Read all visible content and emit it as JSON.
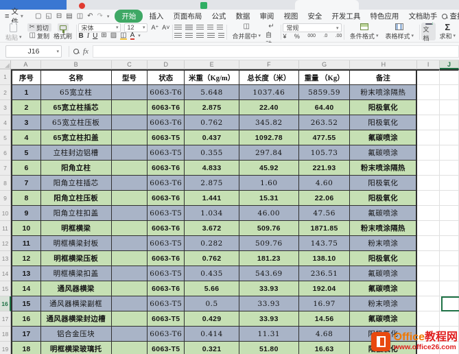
{
  "menu": {
    "file_label": "文件",
    "tabs": [
      "开始",
      "插入",
      "页面布局",
      "公式",
      "数据",
      "审阅",
      "视图",
      "安全",
      "开发工具",
      "特色应用",
      "文档助手"
    ],
    "active_tab": "开始",
    "search_label": "查找"
  },
  "ribbon": {
    "paste_label": "粘贴",
    "cut_label": "剪切",
    "copy_label": "复制",
    "format_painter_label": "格式刷",
    "font_name": "宋体",
    "font_size": "12",
    "merge_center_label": "合并居中",
    "wrap_text_label": "自动换行",
    "number_format_value": "常规",
    "conditional_format_label": "条件格式",
    "table_style_label": "表格样式",
    "doc_assistant_label": "文档助手",
    "sum_label": "求和"
  },
  "formula_bar": {
    "name_box": "J16",
    "fx_label": "fx",
    "formula_value": ""
  },
  "grid": {
    "column_letters": [
      "A",
      "B",
      "C",
      "D",
      "E",
      "F",
      "G",
      "H",
      "I",
      "J"
    ],
    "selected_column": "J",
    "selected_row": 16,
    "selected_cell": "J16",
    "visible_rows": 19
  },
  "table": {
    "headers": [
      "序号",
      "名称",
      "型号",
      "状态",
      "米重（Kg/m）",
      "总长度（米）",
      "重量 （Kg）",
      "备注"
    ],
    "rows": [
      [
        "1",
        "65宽立柱",
        "",
        "6063-T6",
        "5.648",
        "1037.46",
        "5859.59",
        "粉末喷涂隔热"
      ],
      [
        "2",
        "65宽立柱插芯",
        "",
        "6063-T6",
        "2.875",
        "22.40",
        "64.40",
        "阳极氧化"
      ],
      [
        "3",
        "65宽立柱压板",
        "",
        "6063-T6",
        "0.762",
        "345.82",
        "263.52",
        "阳极氧化"
      ],
      [
        "4",
        "65宽立柱扣盖",
        "",
        "6063-T5",
        "0.437",
        "1092.78",
        "477.55",
        "氟碳喷涂"
      ],
      [
        "5",
        "立柱封边铝槽",
        "",
        "6063-T5",
        "0.355",
        "297.84",
        "105.73",
        "氟碳喷涂"
      ],
      [
        "6",
        "阳角立柱",
        "",
        "6063-T6",
        "4.833",
        "45.92",
        "221.93",
        "粉末喷涂隔热"
      ],
      [
        "7",
        "阳角立柱插芯",
        "",
        "6063-T6",
        "2.875",
        "1.60",
        "4.60",
        "阳极氧化"
      ],
      [
        "8",
        "阳角立柱压板",
        "",
        "6063-T6",
        "1.441",
        "15.31",
        "22.06",
        "阳极氧化"
      ],
      [
        "9",
        "阳角立柱扣盖",
        "",
        "6063-T5",
        "1.034",
        "46.00",
        "47.56",
        "氟碳喷涂"
      ],
      [
        "10",
        "明框横梁",
        "",
        "6063-T6",
        "3.672",
        "509.76",
        "1871.85",
        "粉末喷涂隔热"
      ],
      [
        "11",
        "明框横梁封板",
        "",
        "6063-T5",
        "0.282",
        "509.76",
        "143.75",
        "粉末喷涂"
      ],
      [
        "12",
        "明框横梁压板",
        "",
        "6063-T6",
        "0.762",
        "181.23",
        "138.10",
        "阳极氧化"
      ],
      [
        "13",
        "明框横梁扣盖",
        "",
        "6063-T5",
        "0.435",
        "543.69",
        "236.51",
        "氟碳喷涂"
      ],
      [
        "14",
        "通风器横梁",
        "",
        "6063-T6",
        "5.66",
        "33.93",
        "192.04",
        "氟碳喷涂"
      ],
      [
        "15",
        "通风器横梁副框",
        "",
        "6063-T5",
        "0.5",
        "33.93",
        "16.97",
        "粉末喷涂"
      ],
      [
        "16",
        "通风器横梁封边槽",
        "",
        "6063-T5",
        "0.429",
        "33.93",
        "14.56",
        "氟碳喷涂"
      ],
      [
        "17",
        "铝合金压块",
        "",
        "6063-T6",
        "0.414",
        "11.31",
        "4.68",
        "阳极氧化"
      ],
      [
        "18",
        "明框横梁玻璃托",
        "",
        "6063-T5",
        "0.321",
        "51.80",
        "16.63",
        "阳极氧化"
      ]
    ]
  },
  "watermark": {
    "brand_en": "Office",
    "brand_cn": "教程网",
    "url": "www.office26.com"
  },
  "icons": {
    "hamburger": "≡",
    "caret_down": "▾",
    "new_doc": "▢",
    "open": "◱",
    "save": "⊟",
    "print": "▤",
    "preview": "◫",
    "undo": "↶",
    "redo": "↷",
    "scissors": "✂",
    "copy": "◫",
    "font_bigger": "A⁺",
    "font_smaller": "A˅",
    "bold": "B",
    "italic": "I",
    "underline": "U",
    "borders": "⊞",
    "shading": "▨",
    "merge": "◫",
    "wrap": "↵",
    "currency": "¥",
    "percent": "%",
    "thousands": "000",
    "dec_add": ".0",
    "dec_sub": ".00",
    "sigma": "Σ"
  },
  "colors": {
    "accent_green": "#3fa865",
    "selection_green": "#1e7145",
    "row_blue": "#a9b4c7",
    "row_green": "#c6e0b4"
  }
}
